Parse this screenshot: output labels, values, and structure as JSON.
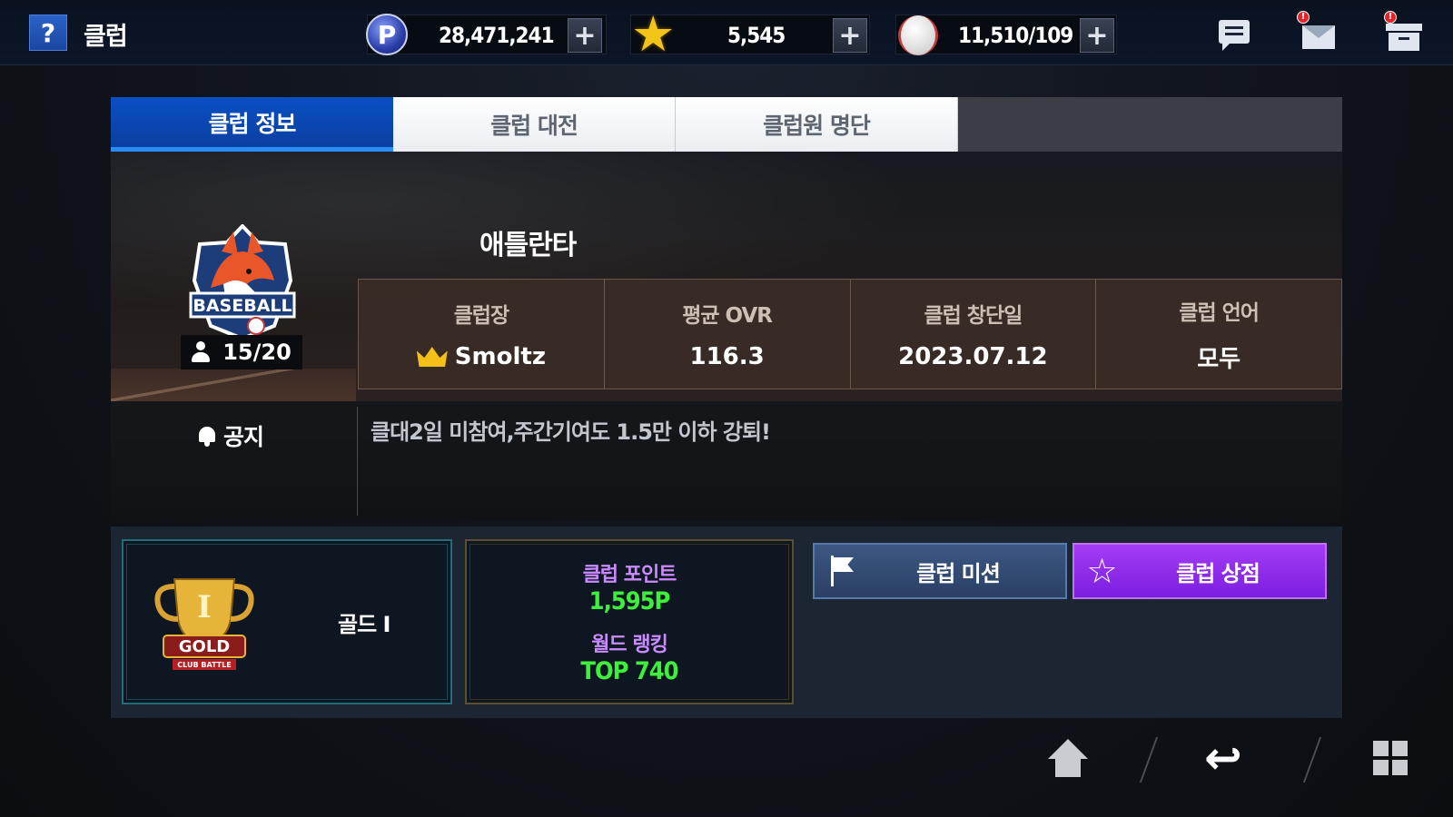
{
  "header": {
    "help_label": "?",
    "title": "클럽",
    "currencies": [
      {
        "icon": "p-coin-icon",
        "value": "28,471,241"
      },
      {
        "icon": "star-icon",
        "value": "5,545"
      },
      {
        "icon": "baseball-icon",
        "value": "11,510/109"
      }
    ],
    "plus_label": "+",
    "icons": [
      "chat-icon",
      "mail-icon",
      "storage-box-icon"
    ],
    "badge_symbol": "!"
  },
  "tabs": [
    {
      "label": "클럽 정보",
      "active": true
    },
    {
      "label": "클럽 대전",
      "active": false
    },
    {
      "label": "클럽원 명단",
      "active": false
    }
  ],
  "club": {
    "name": "애틀란타",
    "emblem_text": "BASEBALL",
    "members": "15/20",
    "stats": [
      {
        "label": "클럽장",
        "value": "Smoltz",
        "icon": "crown-icon"
      },
      {
        "label": "평균 OVR",
        "value": "116.3"
      },
      {
        "label": "클럽 창단일",
        "value": "2023.07.12"
      },
      {
        "label": "클럽 언어",
        "value": "모두"
      }
    ]
  },
  "notice": {
    "label": "공지",
    "text": "클대2일 미참여,주간기여도 1.5만 이하 강퇴!"
  },
  "tier": {
    "trophy_numeral": "I",
    "trophy_text": "GOLD",
    "trophy_subtext": "CLUB BATTLE",
    "name": "골드 I"
  },
  "points": {
    "club_points_label": "클럽 포인트",
    "club_points_value": "1,595P",
    "world_rank_label": "월드 랭킹",
    "world_rank_value": "TOP 740"
  },
  "actions": {
    "mission_label": "클럽 미션",
    "shop_label": "클럽 상점"
  },
  "colors": {
    "tab_active": "#0a4fc5",
    "points_label": "#c98bff",
    "points_value": "#3ef03b",
    "shop_button": "#a53cf5",
    "mission_button": "#3d5884"
  }
}
